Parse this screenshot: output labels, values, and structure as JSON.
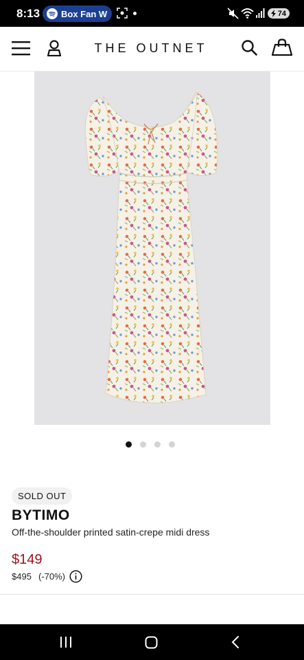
{
  "status_bar": {
    "time": "8:13",
    "spotify_label": "Box Fan W",
    "battery": "74",
    "spotify_color": "#1c3f91"
  },
  "header": {
    "logo": "THE OUTNET"
  },
  "carousel": {
    "total_slides": 4,
    "active_slide": 1
  },
  "product": {
    "badge": "SOLD OUT",
    "brand": "BYTIMO",
    "name": "Off-the-shoulder printed satin-crepe midi dress",
    "sale_price": "$149",
    "original_price": "$495",
    "discount": "(-70%)",
    "sale_color": "#a00f1b"
  },
  "icons": {
    "menu": "menu-icon",
    "account": "account-icon",
    "search": "search-icon",
    "bag": "shopping-bag-icon",
    "info": "info-icon"
  }
}
